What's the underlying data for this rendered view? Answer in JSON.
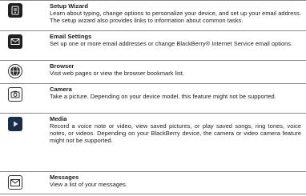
{
  "items": [
    {
      "icon": "setup-wizard-icon",
      "title": "Setup Wizard",
      "desc": "Learn about typing, change options to personalize your device, and set up your email address. The setup wizard also provides links to information about common tasks."
    },
    {
      "icon": "email-settings-icon",
      "title": "Email Settings",
      "desc": "Set up one or more email addresses or change BlackBerry® Internet Service email options."
    },
    {
      "icon": "browser-icon",
      "title": "Browser",
      "desc": "Visit web pages or view the browser bookmark list."
    },
    {
      "icon": "camera-icon",
      "title": "Camera",
      "desc": "Take a picture. Depending on your device model, this feature might not be supported."
    },
    {
      "icon": "media-icon",
      "title": "Media",
      "desc": "Record a voice note or video, view saved pictures, or play saved songs, ring tones, voice notes, or videos. Depending on your BlackBerry device, the camera or video camera feature might not be supported."
    },
    {
      "icon": "messages-icon",
      "title": "Messages",
      "desc": "View a list of your messages."
    }
  ]
}
